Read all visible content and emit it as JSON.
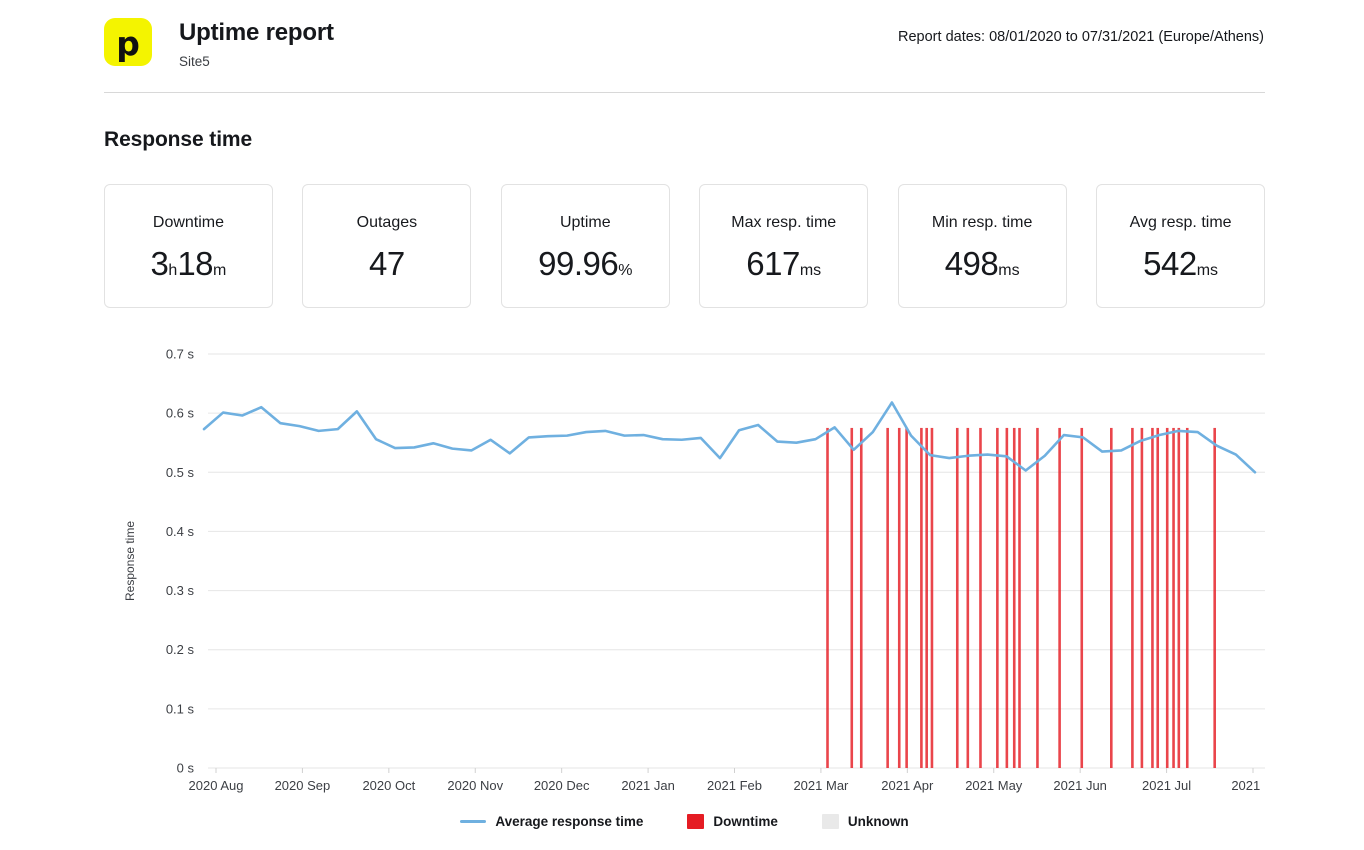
{
  "header": {
    "logo_icon": "pingdom-p-logo-icon",
    "logo_glyph": "p",
    "logo_color": "#F4F400",
    "title": "Uptime report",
    "subtitle": "Site5",
    "report_dates": "Report dates: 08/01/2020 to 07/31/2021 (Europe/Athens)"
  },
  "section": {
    "title": "Response time"
  },
  "stats": [
    {
      "label": "Downtime",
      "value": "3",
      "unit": "h",
      "value2": "18",
      "unit2": "m"
    },
    {
      "label": "Outages",
      "value": "47",
      "unit": "",
      "value2": "",
      "unit2": ""
    },
    {
      "label": "Uptime",
      "value": "99.96",
      "unit": "%",
      "value2": "",
      "unit2": ""
    },
    {
      "label": "Max resp. time",
      "value": "617",
      "unit": "ms",
      "value2": "",
      "unit2": ""
    },
    {
      "label": "Min resp. time",
      "value": "498",
      "unit": "ms",
      "value2": "",
      "unit2": ""
    },
    {
      "label": "Avg resp. time",
      "value": "542",
      "unit": "ms",
      "value2": "",
      "unit2": ""
    }
  ],
  "legend": {
    "average_label": "Average response time",
    "downtime_label": "Downtime",
    "unknown_label": "Unknown",
    "line_color": "#6fb0e0",
    "downtime_color": "#e51c23",
    "unknown_color": "#e9e9e9"
  },
  "chart_data": {
    "type": "line",
    "title": "Response time",
    "xlabel": "",
    "ylabel": "Response time",
    "ylim": [
      0,
      0.7
    ],
    "y_ticks": [
      0,
      0.1,
      0.2,
      0.3,
      0.4,
      0.5,
      0.6,
      0.7
    ],
    "y_tick_labels": [
      "0 s",
      "0.1 s",
      "0.2 s",
      "0.3 s",
      "0.4 s",
      "0.5 s",
      "0.6 s",
      "0.7 s"
    ],
    "grid": true,
    "legend_position": "bottom",
    "x_tick_labels": [
      "2020 Aug",
      "2020 Sep",
      "2020 Oct",
      "2020 Nov",
      "2020 Dec",
      "2021 Jan",
      "2021 Feb",
      "2021 Mar",
      "2021 Apr",
      "2021 May",
      "2021 Jun",
      "2021 Jul",
      "2021 ..."
    ],
    "series": [
      {
        "name": "Average response time",
        "unit": "s",
        "color": "#6fb0e0",
        "values": [
          0.573,
          0.601,
          0.596,
          0.61,
          0.583,
          0.578,
          0.57,
          0.573,
          0.603,
          0.556,
          0.541,
          0.542,
          0.549,
          0.54,
          0.537,
          0.555,
          0.532,
          0.559,
          0.561,
          0.562,
          0.568,
          0.57,
          0.562,
          0.563,
          0.556,
          0.555,
          0.558,
          0.524,
          0.571,
          0.58,
          0.552,
          0.55,
          0.556,
          0.576,
          0.538,
          0.568,
          0.618,
          0.562,
          0.529,
          0.524,
          0.528,
          0.53,
          0.527,
          0.503,
          0.528,
          0.563,
          0.559,
          0.535,
          0.537,
          0.553,
          0.563,
          0.57,
          0.568,
          0.545,
          0.53,
          0.5
        ]
      }
    ],
    "downtime_bars": {
      "name": "Downtime",
      "color": "#e51c23",
      "positions_pct": [
        59.1,
        61.4,
        62.3,
        64.8,
        65.9,
        66.6,
        68.0,
        68.5,
        69.0,
        71.4,
        72.4,
        73.6,
        75.2,
        76.1,
        76.8,
        77.3,
        79.0,
        81.1,
        83.2,
        86.0,
        88.0,
        88.9,
        89.9,
        90.4,
        91.3,
        91.9,
        92.4,
        93.2,
        95.8
      ],
      "heights_pct": [
        100,
        100,
        100,
        100,
        100,
        100,
        100,
        100,
        100,
        100,
        100,
        100,
        100,
        100,
        100,
        100,
        100,
        100,
        100,
        100,
        100,
        100,
        100,
        100,
        100,
        100,
        100,
        100,
        100
      ]
    }
  }
}
